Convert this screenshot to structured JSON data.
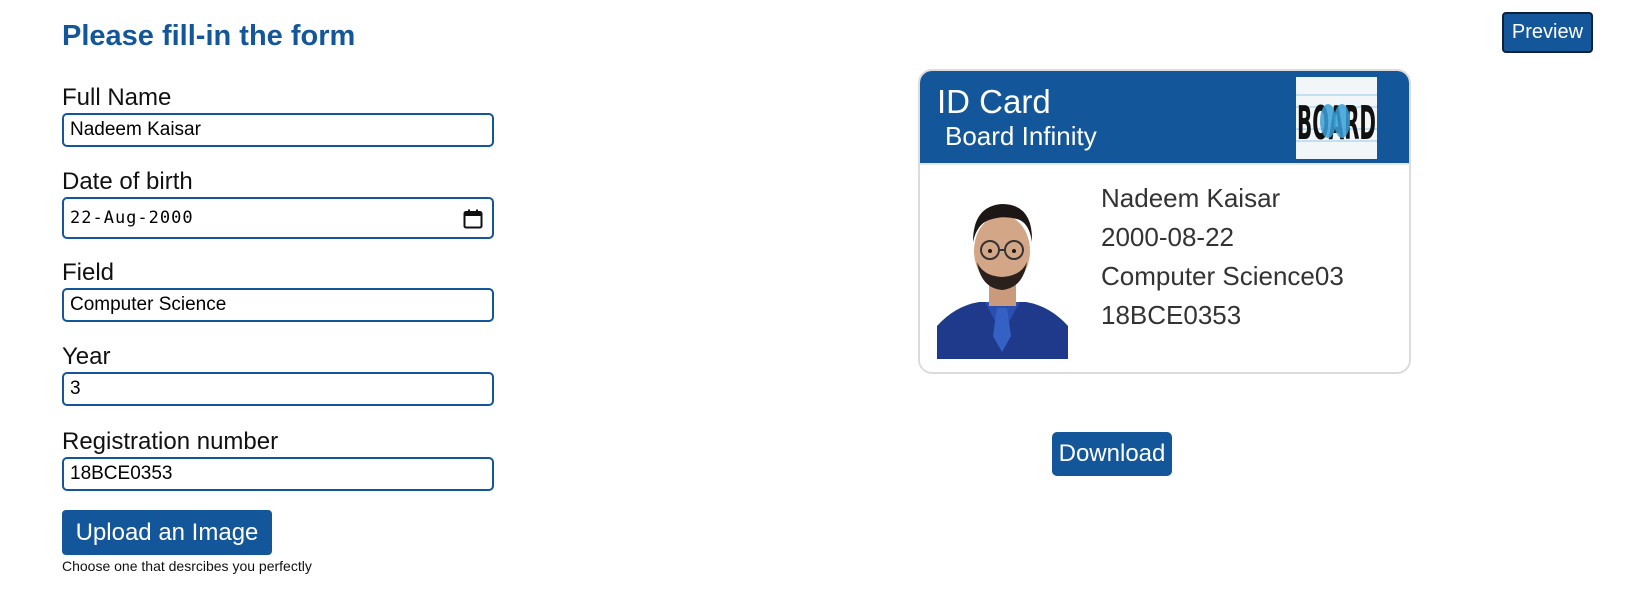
{
  "form": {
    "title": "Please fill-in the form",
    "fields": {
      "full_name": {
        "label": "Full Name",
        "value": "Nadeem Kaisar"
      },
      "dob": {
        "label": "Date of birth",
        "value": "22-Aug-2000"
      },
      "field": {
        "label": "Field",
        "value": "Computer Science"
      },
      "year": {
        "label": "Year",
        "value": "3"
      },
      "reg_number": {
        "label": "Registration number",
        "value": "18BCE0353"
      }
    },
    "upload_label": "Upload an Image",
    "upload_hint": "Choose one that desrcibes you perfectly"
  },
  "preview_label": "Preview",
  "card": {
    "title": "ID Card",
    "org": "Board Infinity",
    "logo_text": "BOARD",
    "name": "Nadeem Kaisar",
    "dob": "2000-08-22",
    "field_year": "Computer Science03",
    "reg": "18BCE0353"
  },
  "download_label": "Download",
  "colors": {
    "primary": "#14569a"
  }
}
